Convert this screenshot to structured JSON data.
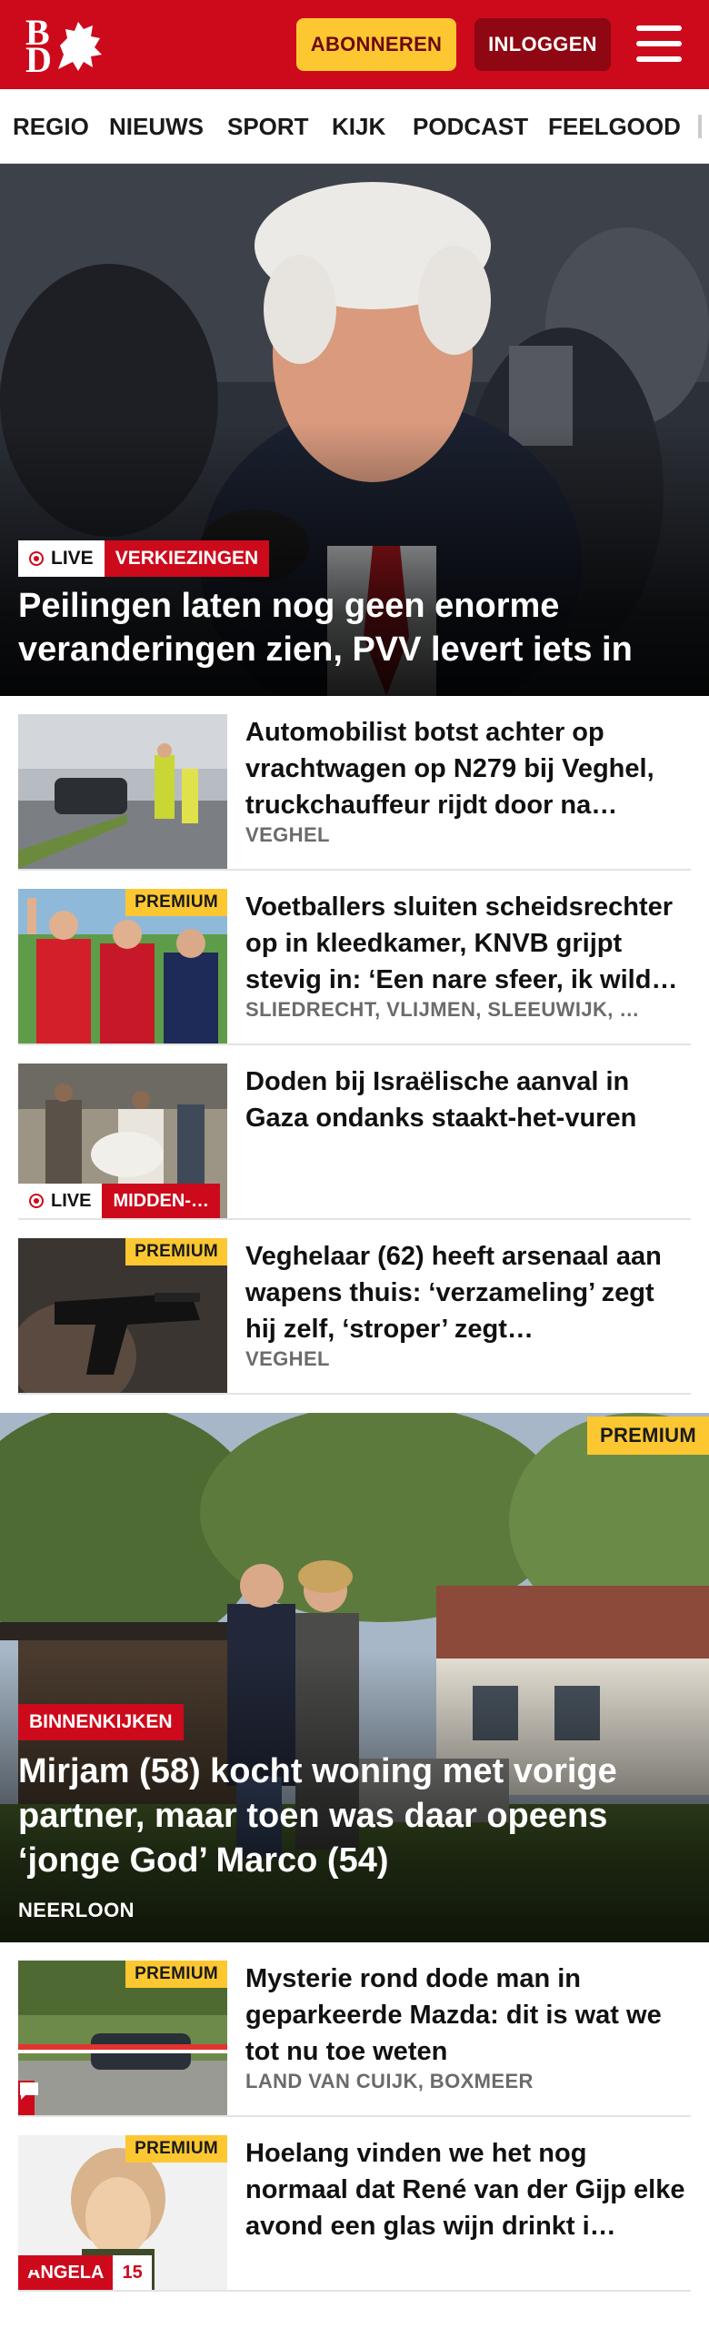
{
  "header": {
    "logo_top": "B",
    "logo_bottom": "D",
    "subscribe_label": "ABONNEREN",
    "login_label": "INLOGGEN",
    "brand_color": "#cc0a1c",
    "menu_icon": "hamburger-menu-icon"
  },
  "nav": {
    "items": [
      "REGIO",
      "NIEUWS",
      "SPORT",
      "KIJK",
      "PODCAST",
      "FEELGOOD"
    ]
  },
  "hero": {
    "live_label": "LIVE",
    "category": "VERKIEZINGEN",
    "title": "Peilingen laten nog geen enorme veranderingen zien, PVV levert iets in"
  },
  "articles": [
    {
      "title": "Automobilist botst achter op vrachtwagen op N279 bij Veghel, truckchauffeur rijdt door na…",
      "meta": "VEGHEL"
    },
    {
      "premium": "PREMIUM",
      "title": "Voetballers sluiten scheidsrech­ter op in kleedkamer, KNVB grijpt stevig in: ‘Een nare sfeer, ik wild…",
      "meta": "SLIEDRECHT, VLIJMEN, SLEEUWIJK, …"
    },
    {
      "title": "Doden bij Israëlische aanval in Gaza ondanks staakt-het-vuren",
      "live_label": "LIVE",
      "category": "MIDDEN-…"
    },
    {
      "premium": "PREMIUM",
      "title": "Veghelaar (62) heeft arsenaal aan wapens thuis: ‘verzameling’ zegt hij zelf, ‘stroper’ zegt…",
      "meta": "VEGHEL"
    }
  ],
  "feature": {
    "premium": "PREMIUM",
    "category": "BINNENKIJKEN",
    "title": "Mirjam (58) kocht woning met vorige partner, maar toen was daar opeens ‘jonge God’ Marco (54)",
    "meta": "NEERLOON"
  },
  "articles2": [
    {
      "premium": "PREMIUM",
      "title": "Mysterie rond dode man in geparkeerde Mazda: dit is wat we tot nu toe weten",
      "meta": "LAND VAN CUIJK, BOXMEER",
      "comment_icon": "comment-icon"
    },
    {
      "premium": "PREMIUM",
      "title": "Hoelang vinden we het nog normaal dat René van der Gijp elke avond een glas wijn drinkt i…",
      "author": "ANGELA",
      "comment_count": "15",
      "comment_icon": "comment-icon"
    }
  ]
}
